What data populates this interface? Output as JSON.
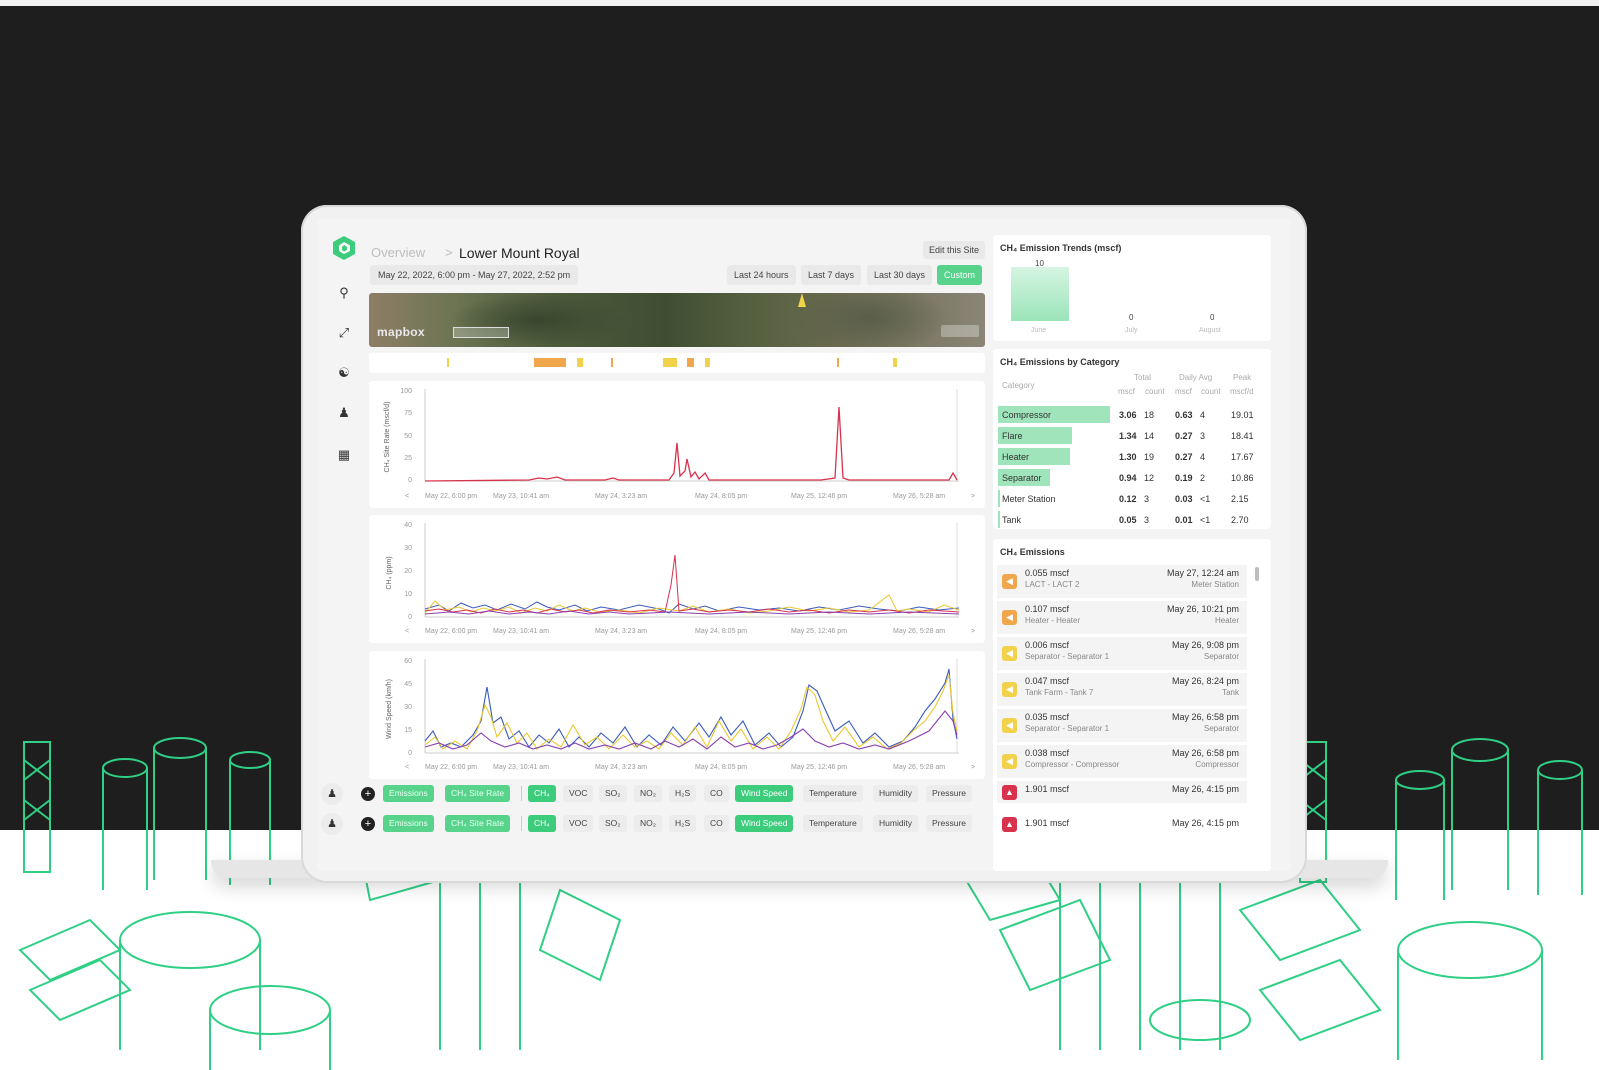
{
  "breadcrumb": {
    "parent": "Overview",
    "separator": ">",
    "current": "Lower Mount Royal"
  },
  "header": {
    "edit_label": "Edit this Site",
    "date_range": "May 22, 2022, 6:00 pm - May 27, 2022, 2:52 pm",
    "ranges": [
      "Last 24 hours",
      "Last 7 days",
      "Last 30 days",
      "Custom"
    ],
    "active_range": "Custom"
  },
  "map": {
    "brand": "mapbox"
  },
  "charts": [
    {
      "ylabel": "CH₄ Site Rate (mscf/d)",
      "yticks": [
        "100",
        "75",
        "50",
        "25",
        "0"
      ],
      "xticks": [
        "May 22, 6:00 pm",
        "May 23, 10:41 am",
        "May 24, 3:23 am",
        "May 24, 8:05 pm",
        "May 25, 12:46 pm",
        "May 26, 5:28 am"
      ]
    },
    {
      "ylabel": "CH₄ (ppm)",
      "yticks": [
        "40",
        "30",
        "20",
        "10",
        "0"
      ],
      "xticks": [
        "May 22, 6:00 pm",
        "May 23, 10:41 am",
        "May 24, 3:23 am",
        "May 24, 8:05 pm",
        "May 25, 12:46 pm",
        "May 26, 5:28 am"
      ]
    },
    {
      "ylabel": "Wind Speed (km/h)",
      "yticks": [
        "60",
        "45",
        "30",
        "15",
        "0"
      ],
      "xticks": [
        "May 22, 6:00 pm",
        "May 23, 10:41 am",
        "May 24, 3:23 am",
        "May 24, 8:05 pm",
        "May 25, 12:46 pm",
        "May 26, 5:28 am"
      ]
    }
  ],
  "trends": {
    "title": "CH₄ Emission Trends (mscf)",
    "months": [
      "June",
      "July",
      "August"
    ],
    "values": [
      "10",
      "0",
      "0"
    ]
  },
  "by_category": {
    "title": "CH₄ Emissions by Category",
    "col_category": "Category",
    "col_total": "Total",
    "col_daily": "Daily Avg",
    "col_peak": "Peak",
    "sub_mscf": "mscf",
    "sub_count": "count",
    "sub_mscfd": "mscf/d",
    "rows": [
      {
        "name": "Compressor",
        "total": "3.06",
        "count": "18",
        "daily": "0.63",
        "dcount": "4",
        "peak": "19.01",
        "share": 1.0
      },
      {
        "name": "Flare",
        "total": "1.34",
        "count": "14",
        "daily": "0.27",
        "dcount": "3",
        "peak": "18.41",
        "share": 0.66
      },
      {
        "name": "Heater",
        "total": "1.30",
        "count": "19",
        "daily": "0.27",
        "dcount": "4",
        "peak": "17.67",
        "share": 0.64
      },
      {
        "name": "Separator",
        "total": "0.94",
        "count": "12",
        "daily": "0.19",
        "dcount": "2",
        "peak": "10.86",
        "share": 0.46
      },
      {
        "name": "Meter Station",
        "total": "0.12",
        "count": "3",
        "daily": "0.03",
        "dcount": "<1",
        "peak": "2.15",
        "share": 0.02
      },
      {
        "name": "Tank",
        "total": "0.05",
        "count": "3",
        "daily": "0.01",
        "dcount": "<1",
        "peak": "2.70",
        "share": 0.01
      }
    ]
  },
  "emissions": {
    "title": "CH₄ Emissions",
    "rows": [
      {
        "value": "0.055 mscf",
        "source": "LACT - LACT 2",
        "date": "May 27, 12:24 am",
        "category": "Meter Station",
        "color": "#f0a64a"
      },
      {
        "value": "0.107 mscf",
        "source": "Heater - Heater",
        "date": "May 26, 10:21 pm",
        "category": "Heater",
        "color": "#f0a64a"
      },
      {
        "value": "0.006 mscf",
        "source": "Separator - Separator 1",
        "date": "May 26, 9:08 pm",
        "category": "Separator",
        "color": "#f2d24a"
      },
      {
        "value": "0.047 mscf",
        "source": "Tank Farm - Tank 7",
        "date": "May 26, 8:24 pm",
        "category": "Tank",
        "color": "#f2d24a"
      },
      {
        "value": "0.035 mscf",
        "source": "Separator - Separator 1",
        "date": "May 26, 6:58 pm",
        "category": "Separator",
        "color": "#f2d24a"
      },
      {
        "value": "0.038 mscf",
        "source": "Compressor - Compressor",
        "date": "May 26, 6:58 pm",
        "category": "Compressor",
        "color": "#f2d24a"
      },
      {
        "value": "1.901 mscf",
        "source": "",
        "date": "May 26, 4:15 pm",
        "category": "",
        "color": "#d8324c"
      }
    ]
  },
  "toolbar": {
    "emissions": "Emissions",
    "site_rate": "CH₄ Site Rate",
    "ch4": "CH₄",
    "voc": "VOC",
    "so2": "SO₂",
    "no2": "NO₂",
    "h2s": "H₂S",
    "co": "CO",
    "wind": "Wind Speed",
    "temperature": "Temperature",
    "humidity": "Humidity",
    "pressure": "Pressure"
  },
  "second_row": {
    "value": "1.901 mscf",
    "date": "May 26, 4:15 pm"
  },
  "colors": {
    "accent": "#57d38c",
    "series_red": "#d8324c",
    "series_blue": "#3a5bbf",
    "series_yellow": "#e9c82e",
    "series_purple": "#8a3fb0",
    "industrial": "#2fcf86"
  }
}
